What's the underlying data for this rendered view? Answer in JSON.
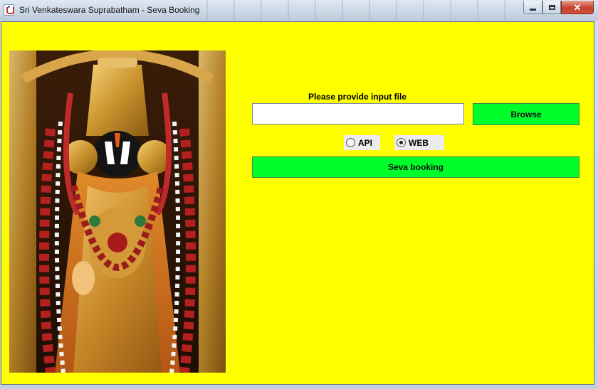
{
  "window": {
    "title": "Sri Venkateswara Suprabatham - Seva Booking",
    "icon": "java-cup-icon",
    "controls": {
      "minimize": "minimize-icon",
      "maximize": "maximize-icon",
      "close": "close-icon"
    }
  },
  "content": {
    "background_color": "#ffff00",
    "image": {
      "subject": "deity-image"
    },
    "file_input": {
      "label": "Please provide input file",
      "value": "",
      "placeholder": ""
    },
    "browse_button": {
      "label": "Browse",
      "color": "#00ff2a"
    },
    "mode": {
      "options": [
        {
          "label": "API",
          "selected": false
        },
        {
          "label": "WEB",
          "selected": true
        }
      ]
    },
    "seva_button": {
      "label": "Seva booking",
      "color": "#00ff2a"
    }
  }
}
